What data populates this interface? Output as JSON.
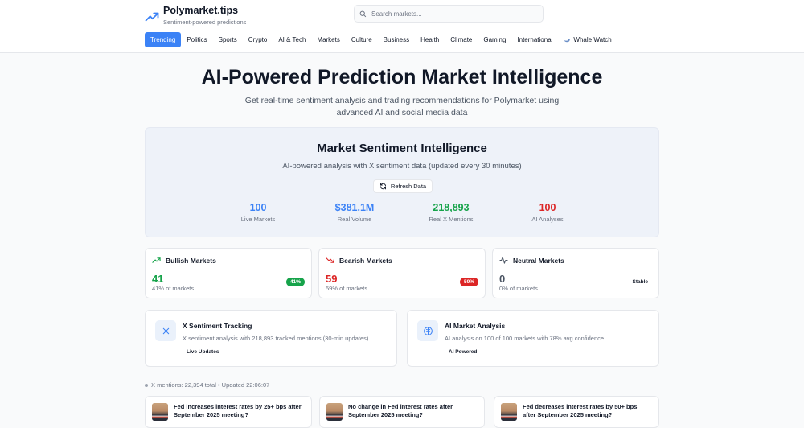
{
  "brand": {
    "title": "Polymarket.tips",
    "subtitle": "Sentiment-powered predictions"
  },
  "search": {
    "placeholder": "Search markets..."
  },
  "nav": [
    {
      "label": "Trending",
      "active": true
    },
    {
      "label": "Politics"
    },
    {
      "label": "Sports"
    },
    {
      "label": "Crypto"
    },
    {
      "label": "AI & Tech"
    },
    {
      "label": "Markets"
    },
    {
      "label": "Culture"
    },
    {
      "label": "Business"
    },
    {
      "label": "Health"
    },
    {
      "label": "Climate"
    },
    {
      "label": "Gaming"
    },
    {
      "label": "International"
    },
    {
      "label": "Whale Watch",
      "icon": "whale-icon"
    }
  ],
  "hero": {
    "title": "AI-Powered Prediction Market Intelligence",
    "subtitle": "Get real-time sentiment analysis and trading recommendations for Polymarket using advanced AI and social media data"
  },
  "sentiment": {
    "title": "Market Sentiment Intelligence",
    "subtitle": "AI-powered analysis with X sentiment data (updated every 30 minutes)",
    "refresh_label": "Refresh Data",
    "stats": [
      {
        "value": "100",
        "label": "Live Markets",
        "color": "#3b82f6"
      },
      {
        "value": "$381.1M",
        "label": "Real Volume",
        "color": "#3b82f6"
      },
      {
        "value": "218,893",
        "label": "Real X Mentions",
        "color": "#16a34a"
      },
      {
        "value": "100",
        "label": "AI Analyses",
        "color": "#dc2626"
      }
    ]
  },
  "market_cards": {
    "bullish": {
      "title": "Bullish Markets",
      "value": "41",
      "sub": "41% of markets",
      "badge": "41%",
      "color": "#16a34a"
    },
    "bearish": {
      "title": "Bearish Markets",
      "value": "59",
      "sub": "59% of markets",
      "badge": "59%",
      "color": "#dc2626"
    },
    "neutral": {
      "title": "Neutral Markets",
      "value": "0",
      "sub": "0% of markets",
      "badge": "Stable",
      "color": "#6b7280"
    }
  },
  "features": {
    "x": {
      "title": "X Sentiment Tracking",
      "desc": "X sentiment analysis with 218,893 tracked mentions (30-min updates).",
      "tag": "Live Updates"
    },
    "ai": {
      "title": "AI Market Analysis",
      "desc": "AI analysis on 100 of 100 markets with 78% avg confidence.",
      "tag": "AI Powered"
    }
  },
  "mentions_status": "X mentions: 22,394 total • Updated 22:06:07",
  "questions": [
    "Fed increases interest rates by 25+ bps after September 2025 meeting?",
    "No change in Fed interest rates after September 2025 meeting?",
    "Fed decreases interest rates by 50+ bps after September 2025 meeting?"
  ]
}
